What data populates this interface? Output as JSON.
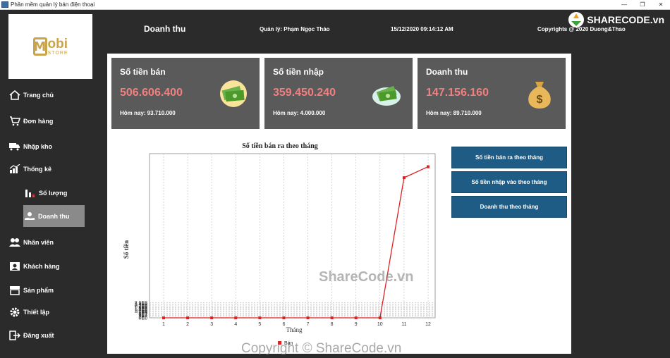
{
  "titlebar": {
    "title": "Phần mềm quản lý bán điện thoại",
    "min": "—",
    "max": "❐",
    "close": "✕"
  },
  "logo": {
    "letter": "M",
    "word": "obi",
    "sub": "STORE"
  },
  "header": {
    "section": "Doanh thu",
    "manager": "Quản lý: Phạm Ngọc Thảo",
    "datetime": "15/12/2020 09:14:12 AM",
    "copyright": "Copyrights @ 2020 Duong&Thao"
  },
  "brand_watermark": {
    "text": "SHARECODE.vn"
  },
  "nav": [
    {
      "label": "Trang chủ",
      "icon": "home-icon"
    },
    {
      "label": "Đơn hàng",
      "icon": "cart-icon"
    },
    {
      "label": "Nhập kho",
      "icon": "truck-icon"
    },
    {
      "label": "Thống kê",
      "icon": "chart-icon"
    },
    {
      "label": "Số lượng",
      "icon": "bar-chart-icon"
    },
    {
      "label": "Doanh thu",
      "icon": "money-hand-icon"
    },
    {
      "label": "Nhân viên",
      "icon": "users-icon"
    },
    {
      "label": "Khách hàng",
      "icon": "id-card-icon"
    },
    {
      "label": "Sản phẩm",
      "icon": "store-icon"
    },
    {
      "label": "Thiết lập",
      "icon": "gear-icon"
    },
    {
      "label": "Đăng xuất",
      "icon": "logout-icon"
    }
  ],
  "cards": [
    {
      "title": "Số tiền bán",
      "value": "506.606.400",
      "today": "Hôm nay: 93.710.000",
      "icon": "cash-icon"
    },
    {
      "title": "Số tiền nhập",
      "value": "359.450.240",
      "today": "Hôm nay: 4.000.000",
      "icon": "cash-cloud-icon"
    },
    {
      "title": "Doanh thu",
      "value": "147.156.160",
      "today": "Hôm nay: 89.710.000",
      "icon": "money-bag-icon"
    }
  ],
  "buttons": [
    "Số tiền bán ra theo tháng",
    "Số tiền nhập vào theo tháng",
    "Doanh thu theo tháng"
  ],
  "watermark": {
    "center": "ShareCode.vn",
    "bottom": "Copyright © ShareCode.vn"
  },
  "colors": {
    "accent": "#1e5c86",
    "card_value": "#f08080",
    "line": "#e02020",
    "bg": "#2b2b2b",
    "card_bg": "#5a5a5a"
  },
  "chart_data": {
    "type": "line",
    "title": "Số tiền bán ra theo tháng",
    "xlabel": "Tháng",
    "ylabel": "Số tiền",
    "categories": [
      "1",
      "2",
      "3",
      "4",
      "5",
      "6",
      "7",
      "8",
      "9",
      "10",
      "11",
      "12"
    ],
    "series": [
      {
        "name": "Bán",
        "values": [
          0,
          0,
          0,
          0,
          0,
          0,
          0,
          0,
          0,
          0,
          2430000000,
          2620000000
        ]
      }
    ],
    "yticks": [
      "0E0",
      "2E7",
      "4E7",
      "6E7",
      "8E7",
      "1E8",
      "1,2E8",
      "1,4E8",
      "1,6E8",
      "1,8E8",
      "2E8",
      "2,2E8",
      "2,4E8",
      "2,6E8"
    ],
    "ylim": [
      0,
      2700000000
    ],
    "grid": true,
    "legend": "bottom"
  }
}
